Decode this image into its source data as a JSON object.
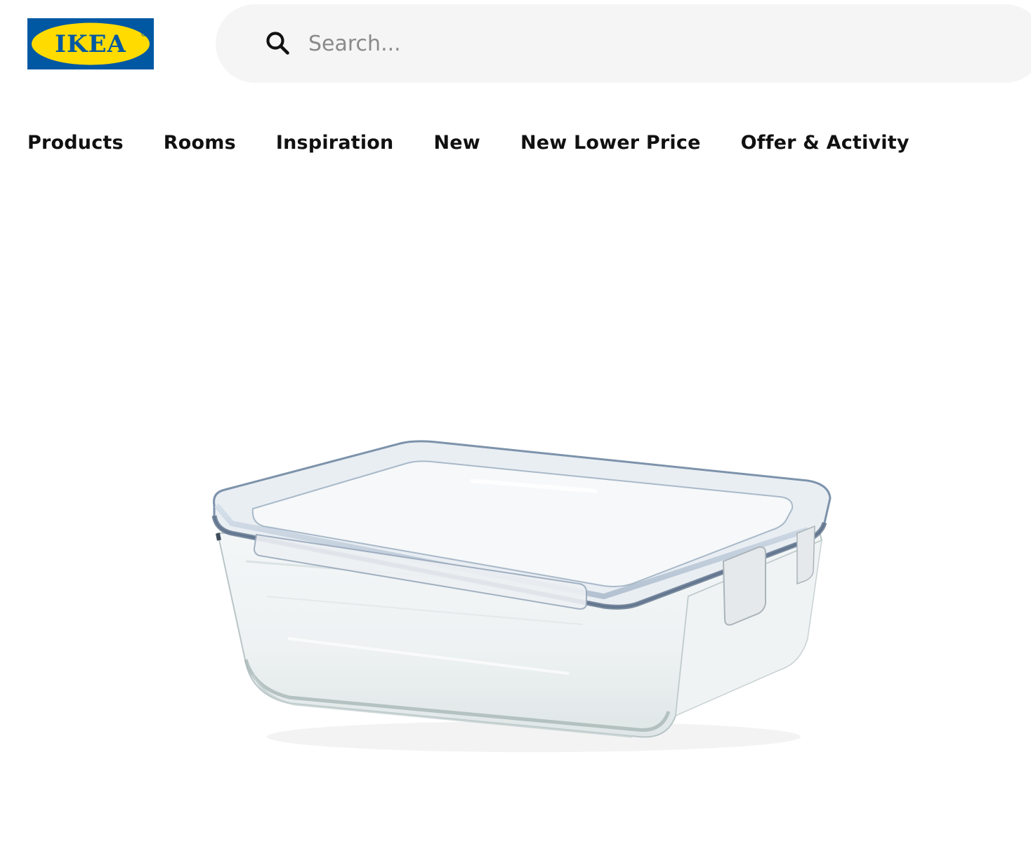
{
  "header": {
    "logo_text": "IKEA",
    "brand_colors": {
      "blue": "#0058a3",
      "yellow": "#ffdb00"
    },
    "search": {
      "placeholder": "Search...",
      "value": "",
      "icon": "search-icon"
    }
  },
  "nav": {
    "items": [
      {
        "label": "Products"
      },
      {
        "label": "Rooms"
      },
      {
        "label": "Inspiration"
      },
      {
        "label": "New"
      },
      {
        "label": "New Lower Price"
      },
      {
        "label": "Offer & Activity"
      }
    ]
  },
  "main": {
    "product_image": {
      "icon": "glass-food-container-with-lid-image"
    }
  }
}
